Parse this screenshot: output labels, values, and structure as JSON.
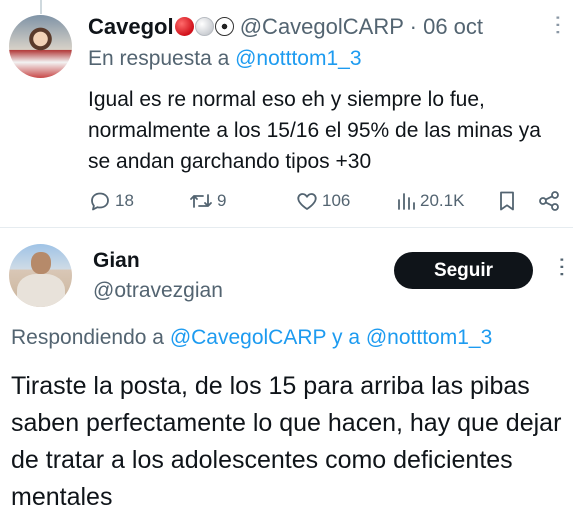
{
  "tweet1": {
    "display_name": "Cavegol",
    "emojis": [
      "red-circle",
      "white-circle",
      "soccer-ball"
    ],
    "handle": "@CavegolCARP",
    "separator": "·",
    "date": "06 oct",
    "reply_prefix": "En respuesta a",
    "reply_handle": "@notttom1_3",
    "text": "Igual es re normal eso eh y siempre lo fue, normalmente a los 15/16 el 95% de las minas ya se andan garchando tipos +30",
    "actions": {
      "replies": "18",
      "retweets": "9",
      "likes": "106",
      "views": "20.1K"
    }
  },
  "tweet2": {
    "display_name": "Gian",
    "handle": "@otravezgian",
    "follow_label": "Seguir",
    "replying_prefix": "Respondiendo a",
    "replying_handle_1": "@CavegolCARP",
    "replying_and": "y a",
    "replying_handle_2": "@notttom1_3",
    "text": "Tiraste la posta, de los 15 para arriba las pibas saben perfectamente lo que hacen, hay que dejar de tratar a los adolescentes como deficientes mentales"
  },
  "colors": {
    "link": "#1d9bf0",
    "muted": "#536471",
    "text": "#0f1419",
    "follow_bg": "#0f1419"
  }
}
